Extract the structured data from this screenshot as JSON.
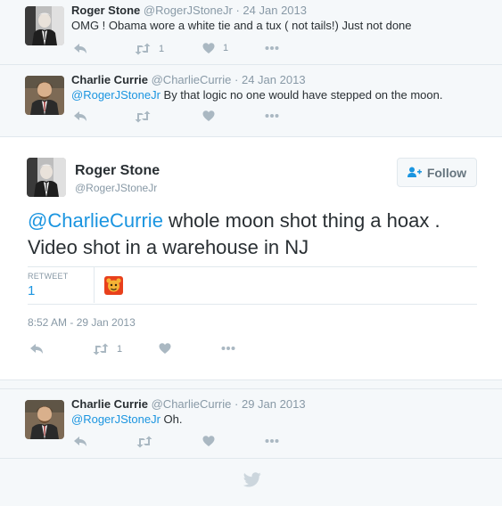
{
  "replies_above": [
    {
      "name": "Roger Stone",
      "handle": "@RogerJStoneJr",
      "dot": "·",
      "time": "24 Jan 2013",
      "text": "OMG ! Obama wore a white tie and a tux ( not tails!) Just not done",
      "retweet_count": "1",
      "like_count": "1"
    },
    {
      "name": "Charlie Currie",
      "handle": "@CharlieCurrie",
      "dot": "·",
      "time": "24 Jan 2013",
      "mention": "@RogerJStoneJr",
      "text": " By that logic no one would have stepped on the moon."
    }
  ],
  "main_tweet": {
    "name": "Roger Stone",
    "handle": "@RogerJStoneJr",
    "follow_label": "Follow",
    "mention": "@CharlieCurrie",
    "text": " whole moon shot thing a hoax . Video shot in a warehouse in NJ",
    "retweet_label": "RETWEET",
    "retweet_count": "1",
    "timestamp": "8:52 AM - 29 Jan 2013",
    "action_retweet_count": "1"
  },
  "replies_below": [
    {
      "name": "Charlie Currie",
      "handle": "@CharlieCurrie",
      "dot": "·",
      "time": "29 Jan 2013",
      "mention": "@RogerJStoneJr",
      "text": " Oh."
    }
  ],
  "icons": {
    "reply": "reply-icon",
    "retweet": "retweet-icon",
    "like": "heart-icon",
    "more": "more-dots-icon",
    "follow": "follow-person-icon",
    "footer": "twitter-bird-icon"
  },
  "colors": {
    "link": "#1b95e0",
    "muted": "#8899a6",
    "icon": "#aab8c2",
    "text": "#292f33",
    "background": "#f5f8fa",
    "card": "#ffffff"
  }
}
